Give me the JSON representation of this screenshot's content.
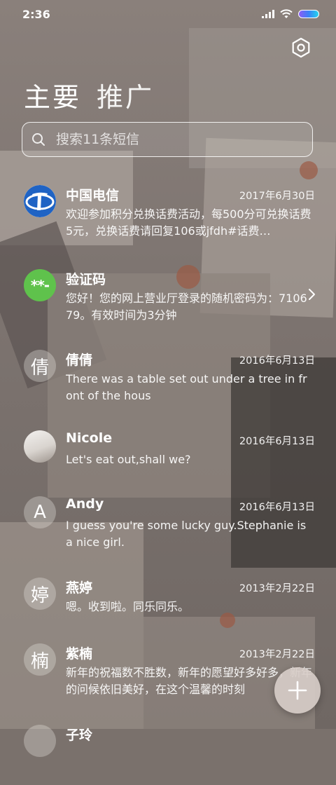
{
  "status_bar": {
    "time": "2:36"
  },
  "header": {
    "tabs": [
      {
        "label": "主要"
      },
      {
        "label": "推广"
      }
    ]
  },
  "search": {
    "placeholder": "搜索11条短信"
  },
  "conversations": [
    {
      "avatar_text": "",
      "name": "中国电信",
      "date": "2017年6月30日",
      "preview": "欢迎参加积分兑换话费活动，每500分可兑换话费5元，兑换话费请回复106或jfdh#话费…"
    },
    {
      "avatar_text": "**-",
      "name": "验证码",
      "date": "",
      "preview": "您好！您的网上营业厅登录的随机密码为：710679。有效时间为3分钟"
    },
    {
      "avatar_text": "倩",
      "name": "倩倩",
      "date": "2016年6月13日",
      "preview": "There was a table set out under a tree in front of the hous"
    },
    {
      "avatar_text": "",
      "name": "Nicole",
      "date": "2016年6月13日",
      "preview": "Let's eat out,shall we?"
    },
    {
      "avatar_text": "A",
      "name": "Andy",
      "date": "2016年6月13日",
      "preview": "I guess you're some lucky guy.Stephanie is a nice girl."
    },
    {
      "avatar_text": "婷",
      "name": "燕婷",
      "date": "2013年2月22日",
      "preview": "嗯。收到啦。同乐同乐。"
    },
    {
      "avatar_text": "楠",
      "name": "紫楠",
      "date": "2013年2月22日",
      "preview": "新年的祝福数不胜数，新年的愿望好多好多，新年的问候依旧美好，在这个温馨的时刻"
    },
    {
      "avatar_text": "",
      "name": "子玲",
      "date": "",
      "preview": ""
    }
  ],
  "icons": {
    "settings": "gear-icon",
    "search": "search-icon",
    "compose": "plus-icon",
    "chevron": "chevron-right-icon"
  },
  "colors": {
    "verification_avatar": "#5fc24c",
    "telecom_logo": "#1f63c4"
  }
}
